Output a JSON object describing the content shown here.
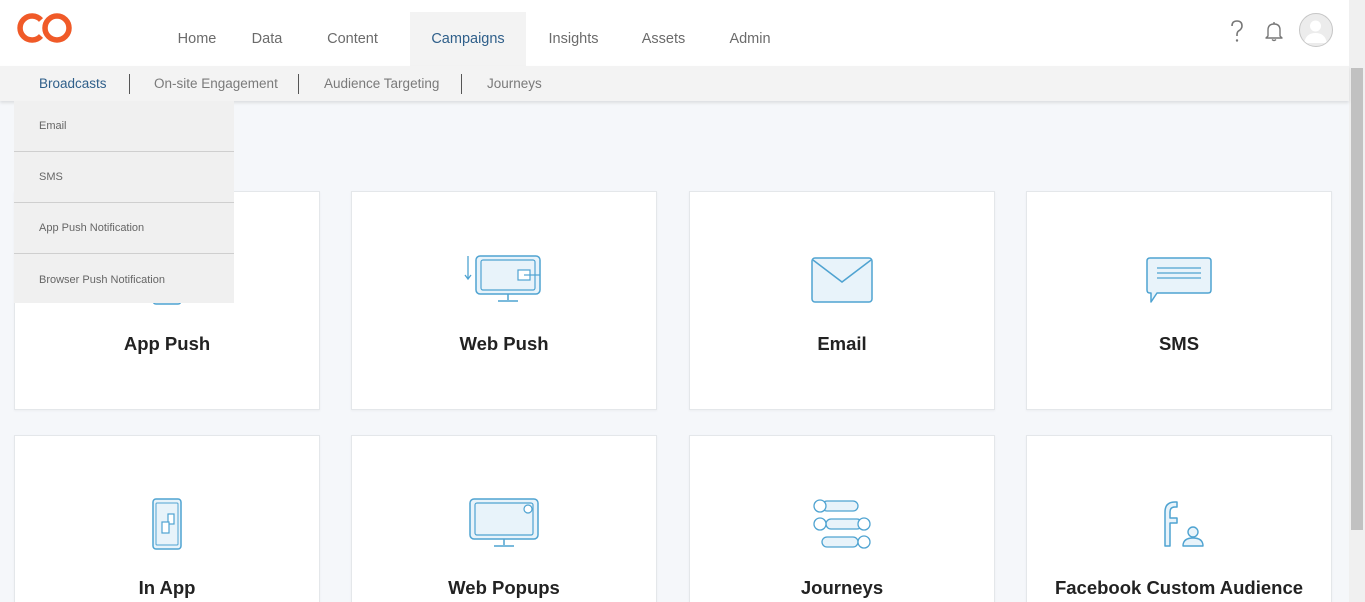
{
  "brand": {
    "color": "#f05a28",
    "accent": "#2f5f8a",
    "icon_color": "#4fa3d1"
  },
  "nav": {
    "items": [
      {
        "label": "Home"
      },
      {
        "label": "Data"
      },
      {
        "label": "Content"
      },
      {
        "label": "Campaigns",
        "active": true
      },
      {
        "label": "Insights"
      },
      {
        "label": "Assets"
      },
      {
        "label": "Admin"
      }
    ]
  },
  "top_icons": [
    "help-icon",
    "bell-icon",
    "user-avatar-icon"
  ],
  "subnav": {
    "items": [
      {
        "label": "Broadcasts",
        "active": true
      },
      {
        "label": "On-site Engagement"
      },
      {
        "label": "Audience Targeting"
      },
      {
        "label": "Journeys"
      }
    ]
  },
  "dropdown": {
    "items": [
      {
        "label": "Email"
      },
      {
        "label": "SMS"
      },
      {
        "label": "App Push Notification"
      },
      {
        "label": "Browser Push Notification"
      }
    ]
  },
  "cards": [
    {
      "label": "App Push",
      "icon": "mobile-icon"
    },
    {
      "label": "Web Push",
      "icon": "web-push-monitor-icon"
    },
    {
      "label": "Email",
      "icon": "envelope-icon"
    },
    {
      "label": "SMS",
      "icon": "chat-bubble-icon"
    },
    {
      "label": "In App",
      "icon": "in-app-phone-icon"
    },
    {
      "label": "Web Popups",
      "icon": "web-popup-monitor-icon"
    },
    {
      "label": "Journeys",
      "icon": "journeys-flow-icon"
    },
    {
      "label": "Facebook Custom Audience",
      "icon": "facebook-audience-icon"
    }
  ]
}
